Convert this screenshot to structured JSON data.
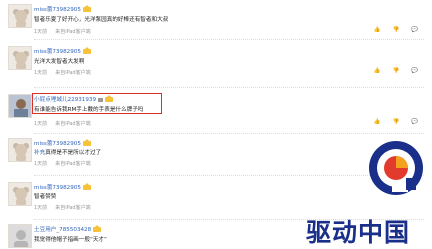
{
  "comments": [
    {
      "user": "miss蕾73982905",
      "text": "智者乐夏了好开心，光洋泵园真的好棒还有智者和大叔",
      "time": "1天前",
      "source": "来自iPad客户端",
      "vip": true
    },
    {
      "user": "miss蕾73982905",
      "text": "光洋大发智者大发啊",
      "time": "1天前",
      "source": "来自iPad客户端",
      "vip": true
    },
    {
      "user": "小屁点哩城儿22931939",
      "text": "有谁能告诉我RM手上戴的手表是什么牌子吗",
      "time": "1天前",
      "source": "来自iPad客户端",
      "vip": true
    },
    {
      "user": "miss蕾73982905",
      "text_prefix": "补充",
      "text_rest": "真得是不是所以才过了",
      "time": "1天前",
      "source": "来自iPad客户端",
      "vip": true
    },
    {
      "user": "miss蕾73982905",
      "text": "智者赞赞",
      "time": "1天前",
      "source": "来自iPad客户端",
      "vip": true
    },
    {
      "user": "土豆用户_785503428",
      "text": "我觉得他帽子指画一般“天才”",
      "time": "",
      "source": "",
      "vip": true
    }
  ],
  "actions": {
    "like": "👍",
    "dislike": "👎",
    "reply": "💬"
  },
  "watermark": {
    "text": "驱动中国",
    "colors": {
      "blue": "#1a2f8a",
      "red": "#e23b2e",
      "orange": "#f4a21d"
    }
  },
  "highlight_color": "#d9302a"
}
